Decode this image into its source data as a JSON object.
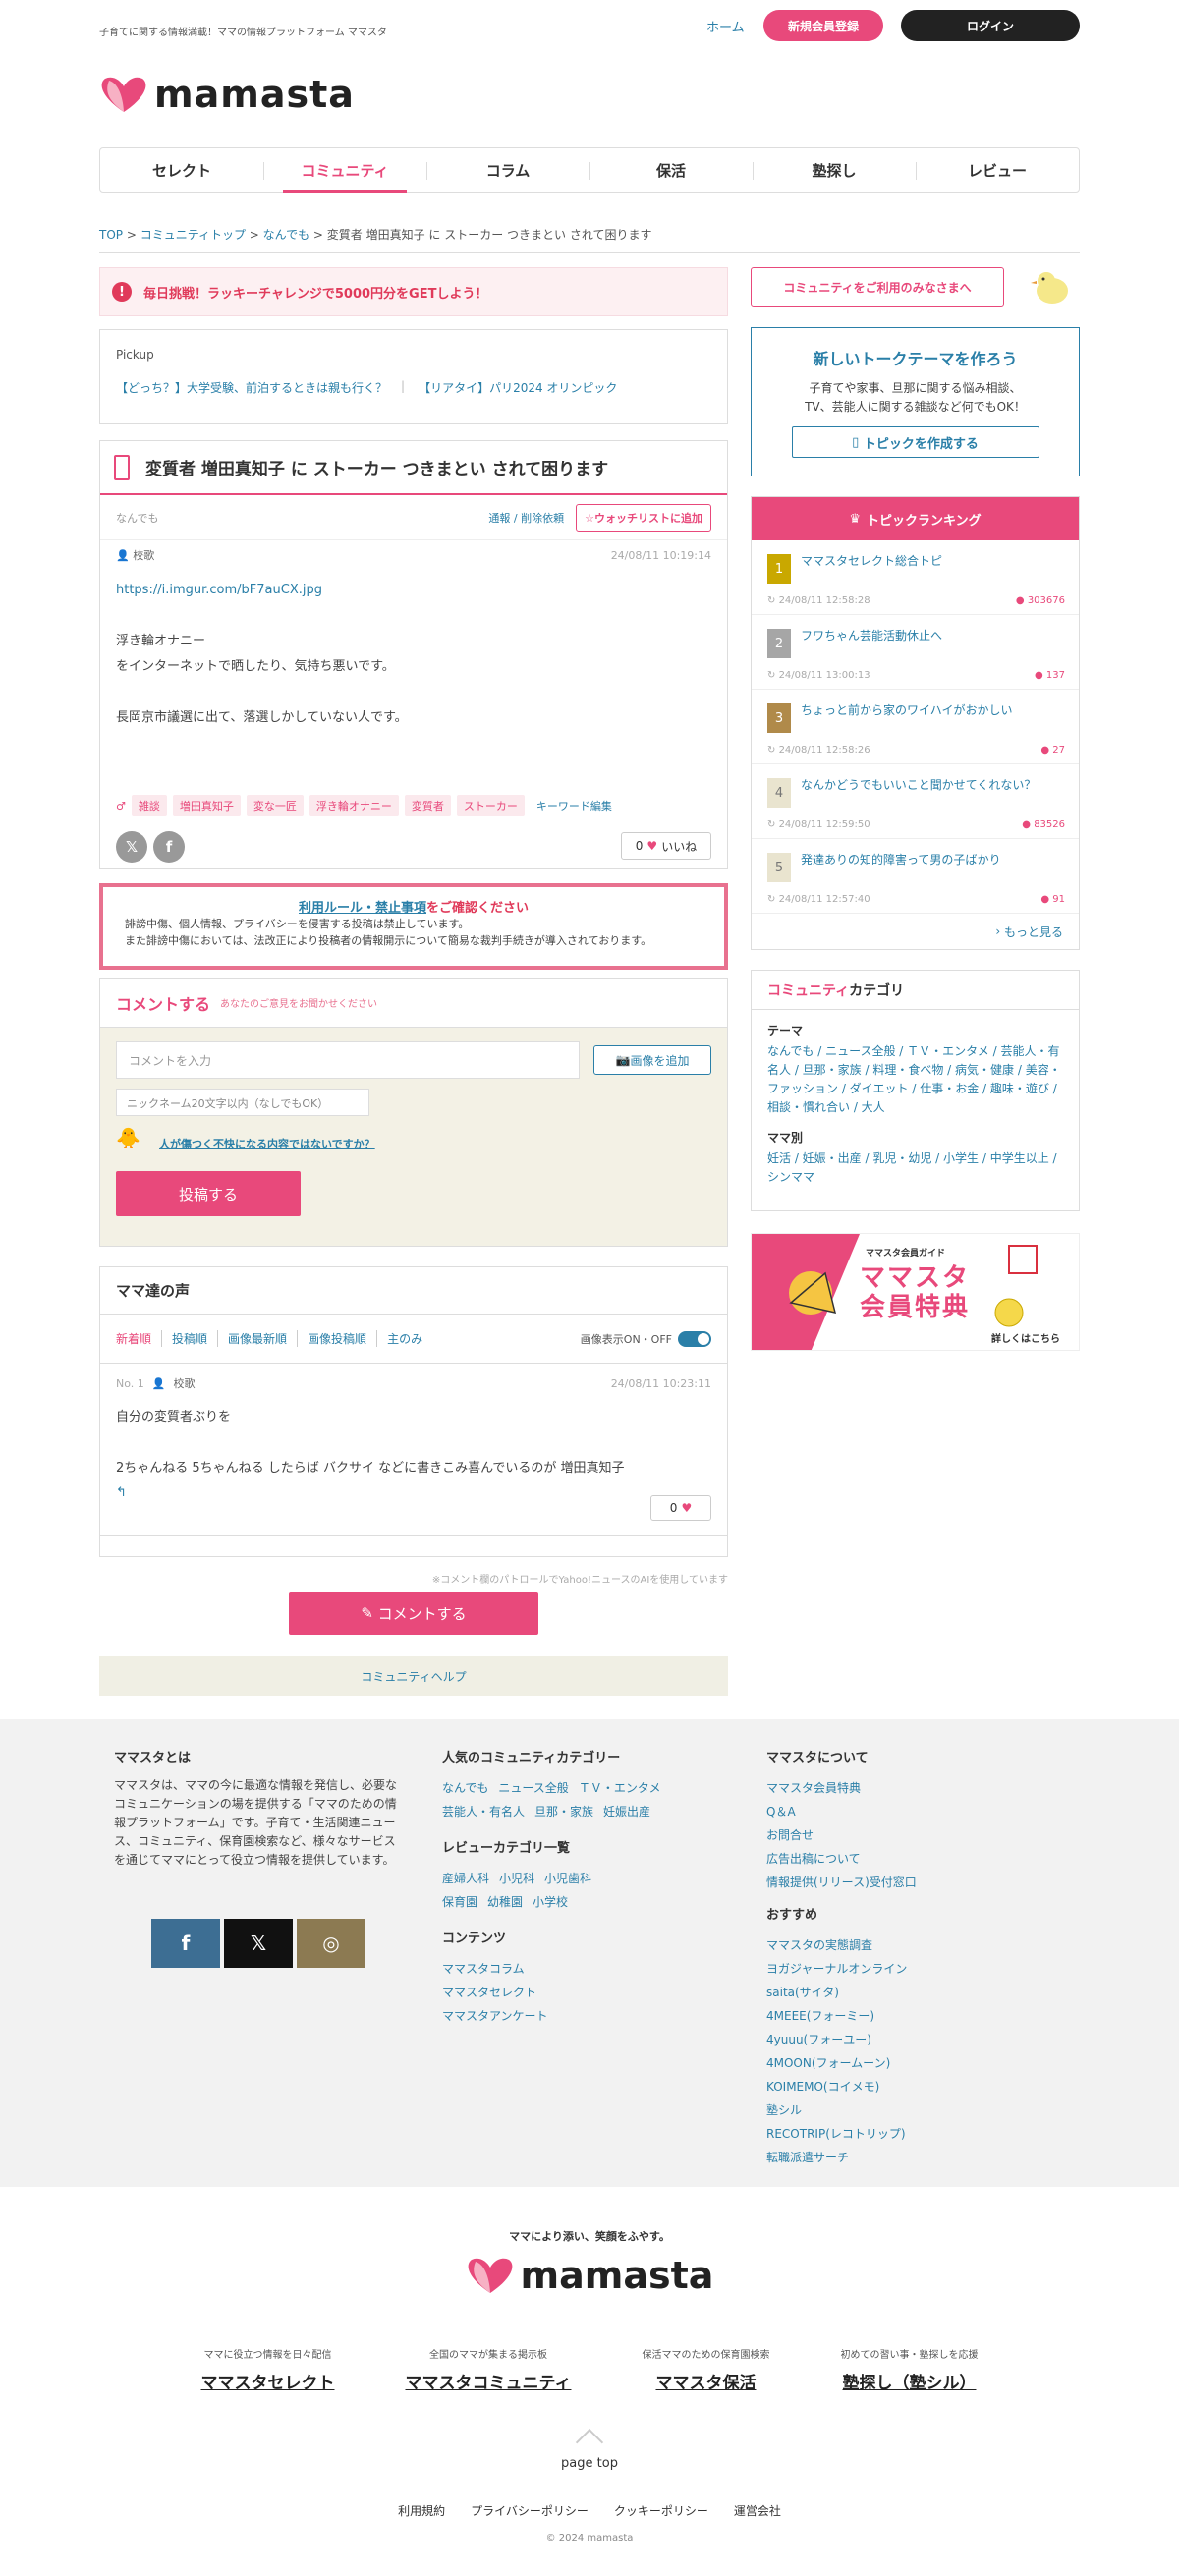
{
  "header": {
    "tagline": "子育てに関する情報満載！ママの情報プラットフォーム ママスタ",
    "home": "ホーム",
    "register": "新規会員登録",
    "login": "ログイン",
    "logo": "mamasta"
  },
  "nav": [
    "セレクト",
    "コミュニティ",
    "コラム",
    "保活",
    "塾探し",
    "レビュー"
  ],
  "breadcrumb": [
    "TOP",
    "コミュニティトップ",
    "なんでも",
    "変質者 増田真知子 に ストーカー つきまとい されて困ります"
  ],
  "alert": {
    "icon": "!",
    "text": "毎日挑戦！ラッキーチャレンジで5000円分をGETしよう！"
  },
  "pickup": {
    "label": "Pickup",
    "links": [
      "【どっち？】大学受験、前泊するときは親も行く？",
      "【リアタイ】パリ2024 オリンピック"
    ]
  },
  "topic": {
    "title": "変質者 増田真知子 に ストーカー つきまとい されて困ります",
    "category": "なんでも",
    "report": "通報 / 削除依頼",
    "watch": "☆ウォッチリストに追加",
    "author": "校歌",
    "date": "24/08/11 10:19:14",
    "link": "https://i.imgur.com/bF7auCX.jpg",
    "lines": [
      "浮き輪オナニー",
      "をインターネットで晒したり、気持ち悪いです。",
      "",
      "長岡京市議選に出て、落選しかしていない人です。"
    ],
    "tags": [
      "雑談",
      "増田真知子",
      "変な一匠",
      "浮き輪オナニー",
      "変質者",
      "ストーカー"
    ],
    "keyword_edit": "キーワード編集",
    "like_count": "0",
    "like_label": "いいね"
  },
  "rules": {
    "link": "利用ルール・禁止事項",
    "suffix": "をご確認ください",
    "line1": "誹謗中傷、個人情報、プライバシーを侵害する投稿は禁止しています。",
    "line2": "また誹謗中傷においては、法改正により投稿者の情報開示について簡易な裁判手続きが導入されております。"
  },
  "comment_form": {
    "title": "コメントする",
    "note": "あなたのご意見をお聞かせください",
    "placeholder": "コメントを入力",
    "image_btn": "画像を追加",
    "nick_placeholder": "ニックネーム20文字以内（なしでもOK）",
    "warn": "人が傷つく不快になる内容ではないですか？",
    "submit": "投稿する"
  },
  "voices": {
    "title": "ママ達の声",
    "tabs": [
      "新着順",
      "投稿順",
      "画像最新順",
      "画像投稿順",
      "主のみ"
    ],
    "toggle": "画像表示ON・OFF",
    "items": [
      {
        "no": "No. 1",
        "author": "校歌",
        "date": "24/08/11 10:23:11",
        "line1": "自分の変質者ぶりを",
        "line2": "2ちゃんねる 5ちゃんねる したらば バクサイ などに書きこみ喜んでいるのが 増田真知子",
        "likes": "0"
      }
    ]
  },
  "ai_note": "※コメント欄のパトロールでYahoo!ニュースのAIを使用しています",
  "comment_btn": "コメントする",
  "help": "コミュニティヘルプ",
  "side": {
    "notice": "コミュニティをご利用のみなさまへ",
    "newtopic_title": "新しいトークテーマを作ろう",
    "newtopic_line1": "子育てや家事、旦那に関する悩み相談、",
    "newtopic_line2": "TV、芸能人に関する雑談など何でもOK！",
    "newtopic_btn": "トピックを作成する",
    "ranking_title": "トピックランキング",
    "ranking": [
      {
        "n": "1",
        "title": "ママスタセレクト総合トピ",
        "date": "24/08/11 12:58:28",
        "count": "303676",
        "color": "#c9a800"
      },
      {
        "n": "2",
        "title": "フワちゃん芸能活動休止へ",
        "date": "24/08/11 13:00:13",
        "count": "137",
        "color": "#a6a6a6"
      },
      {
        "n": "3",
        "title": "ちょっと前から家のワイハイがおかしい",
        "date": "24/08/11 12:58:26",
        "count": "27",
        "color": "#b08a4a"
      },
      {
        "n": "4",
        "title": "なんかどうでもいいこと聞かせてくれない？",
        "date": "24/08/11 12:59:50",
        "count": "83526",
        "color": "#e9e4cf"
      },
      {
        "n": "5",
        "title": "発達ありの知的障害って男の子ばかり",
        "date": "24/08/11 12:57:40",
        "count": "91",
        "color": "#e9e4cf"
      }
    ],
    "more": "もっと見る",
    "cat_title_a": "コミュニティ",
    "cat_title_b": "カテゴリ",
    "theme_label": "テーマ",
    "theme_links": "なんでも / ニュース全般 / ＴＶ・エンタメ / 芸能人・有名人 / 旦那・家族 / 料理・食べ物 / 病気・健康 / 美容・ファッション / ダイエット / 仕事・お金 / 趣味・遊び / 相談・慣れ合い / 大人",
    "mama_label": "ママ別",
    "mama_links": "妊活 / 妊娠・出産 / 乳児・幼児 / 小学生 / 中学生以上 / シンママ",
    "guide_small": "ママスタ会員ガイド",
    "guide_big1": "ママスタ",
    "guide_big2": "会員特典",
    "guide_more": "詳しくはこちら"
  },
  "footer": {
    "about_title": "ママスタとは",
    "about_text": "ママスタは、ママの今に最適な情報を発信し、必要なコミュニケーションの場を提供する「ママのための情報プラットフォーム」です。子育て・生活関連ニュース、コミュニティ、保育園検索など、様々なサービスを通じてママにとって役立つ情報を提供しています。",
    "pop_title": "人気のコミュニティカテゴリー",
    "pop_row1": [
      "なんでも",
      "ニュース全般",
      "ＴＶ・エンタメ"
    ],
    "pop_row2": [
      "芸能人・有名人",
      "旦那・家族",
      "妊娠出産"
    ],
    "review_title": "レビューカテゴリ一覧",
    "review_row1": [
      "産婦人科",
      "小児科",
      "小児歯科"
    ],
    "review_row2": [
      "保育園",
      "幼稚園",
      "小学校"
    ],
    "contents_title": "コンテンツ",
    "contents": [
      "ママスタコラム",
      "ママスタセレクト",
      "ママスタアンケート"
    ],
    "about2_title": "ママスタについて",
    "about2": [
      "ママスタ会員特典",
      "Q＆A",
      "お問合せ",
      "広告出稿について",
      "情報提供(リリース)受付窓口"
    ],
    "rec_title": "おすすめ",
    "rec": [
      "ママスタの実態調査",
      "ヨガジャーナルオンライン",
      "saita(サイタ)",
      "4MEEE(フォーミー)",
      "4yuuu(フォーユー)",
      "4MOON(フォームーン)",
      "KOIMEMO(コイメモ)",
      "塾シル",
      "RECOTRIP(レコトリップ)",
      "転職派遣サーチ"
    ]
  },
  "bottom": {
    "tagline": "ママにより添い、笑顔をふやす。",
    "logo": "mamasta",
    "sites": [
      {
        "desc": "ママに役立つ情報を日々配信",
        "name": "ママスタセレクト"
      },
      {
        "desc": "全国のママが集まる掲示板",
        "name": "ママスタコミュニティ"
      },
      {
        "desc": "保活ママのための保育園検索",
        "name": "ママスタ保活"
      },
      {
        "desc": "初めての習い事・塾探しを応援",
        "name": "塾探し（塾シル）"
      }
    ],
    "pagetop": "page top",
    "links": [
      "利用規約",
      "プライバシーポリシー",
      "クッキーポリシー",
      "運営会社"
    ],
    "copyright": "© 2024 mamasta"
  }
}
